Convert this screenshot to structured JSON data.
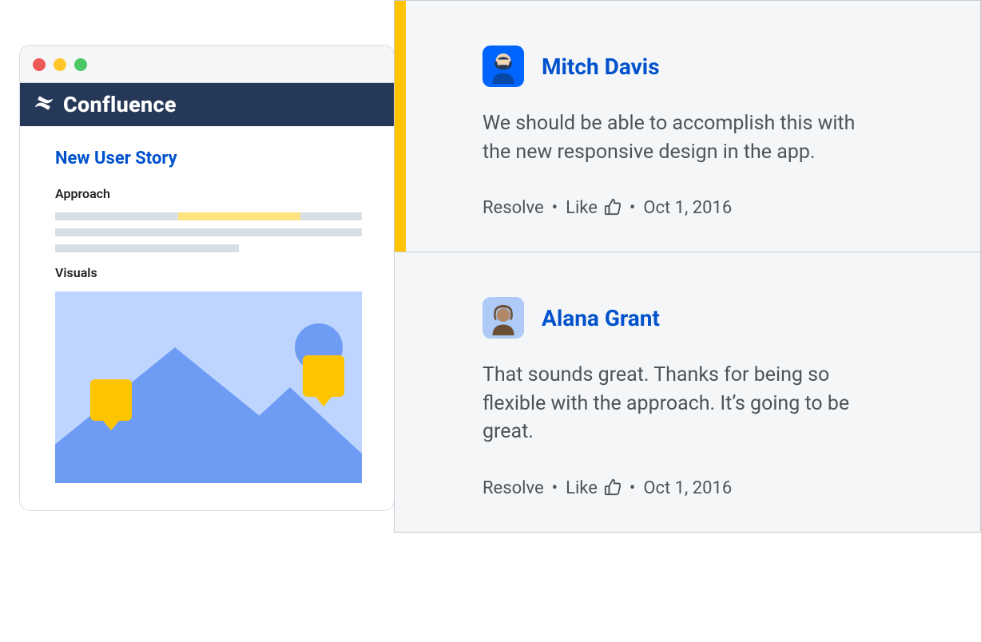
{
  "app": {
    "name": "Confluence"
  },
  "page": {
    "title": "New User Story",
    "sections": {
      "approach": {
        "heading": "Approach"
      },
      "visuals": {
        "heading": "Visuals"
      }
    }
  },
  "comments": [
    {
      "author": "Mitch Davis",
      "body": "We should be able to accomplish this with the new responsive design in the app.",
      "date": "Oct 1, 2016",
      "actions": {
        "resolve": "Resolve",
        "like": "Like"
      },
      "highlighted": true
    },
    {
      "author": "Alana Grant",
      "body": "That sounds great. Thanks for being so flexible with the approach. It’s going to be great.",
      "date": "Oct 1, 2016",
      "actions": {
        "resolve": "Resolve",
        "like": "Like"
      },
      "highlighted": false
    }
  ],
  "ui": {
    "separator": "•"
  }
}
